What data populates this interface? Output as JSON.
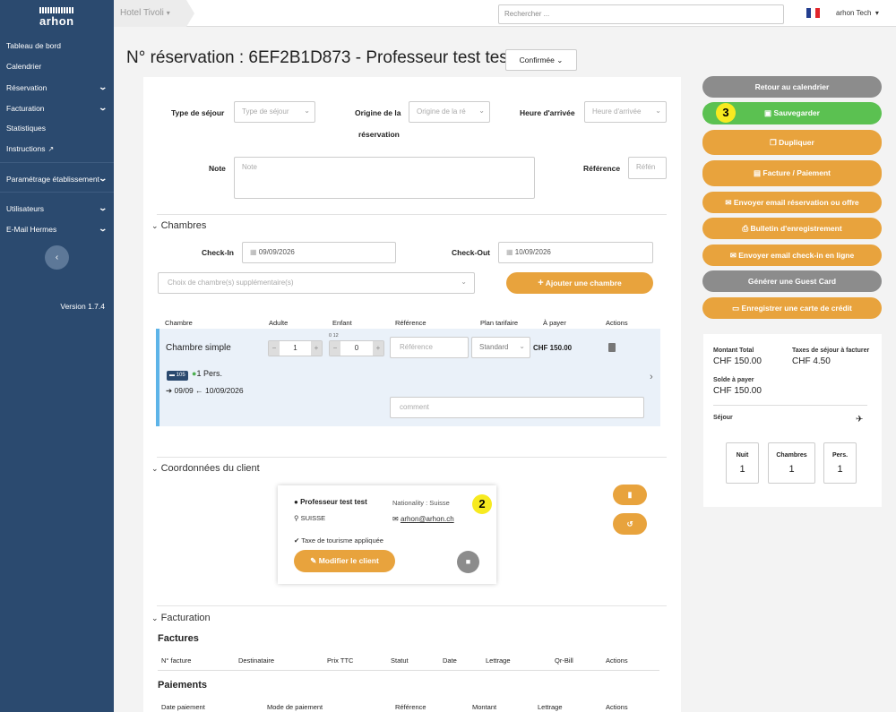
{
  "app": {
    "logo_text": "arhon",
    "version": "Version 1.7.4"
  },
  "sidebar": {
    "items": [
      {
        "label": "Tableau de bord",
        "chevron": false
      },
      {
        "label": "Calendrier",
        "chevron": false
      },
      {
        "label": "Réservation",
        "chevron": true
      },
      {
        "label": "Facturation",
        "chevron": true
      },
      {
        "label": "Statistiques",
        "chevron": false
      },
      {
        "label": "Instructions",
        "chevron": false
      },
      {
        "label": "Paramétrage établissement",
        "chevron": true
      },
      {
        "label": "Utilisateurs",
        "chevron": true
      },
      {
        "label": "E-Mail Hermes",
        "chevron": true
      }
    ]
  },
  "topbar": {
    "hotel": "Hotel Tivoli",
    "search_placeholder": "Rechercher ...",
    "user": "arhon Tech"
  },
  "page": {
    "title": "N° réservation : 6EF2B1D873 - Professeur test test",
    "status": "Confirmée"
  },
  "form": {
    "type_sejour_label": "Type de séjour",
    "type_sejour_placeholder": "Type de séjour",
    "origine_label_1": "Origine de la",
    "origine_label_2": "réservation",
    "origine_placeholder": "Origine de la ré",
    "heure_label": "Heure d'arrivée",
    "heure_placeholder": "Heure d'arrivée",
    "note_label": "Note",
    "note_placeholder": "Note",
    "reference_label": "Référence",
    "reference_placeholder": "Réfén"
  },
  "chambres": {
    "title": "Chambres",
    "checkin_label": "Check-In",
    "checkin": "09/09/2026",
    "checkout_label": "Check-Out",
    "checkout": "10/09/2026",
    "choice_placeholder": "Choix de chambre(s) supplémentaire(s)",
    "add_button": "Ajouter une chambre",
    "headers": [
      "Chambre",
      "Adulte",
      "Enfant",
      "Référence",
      "Plan tarifaire",
      "À payer",
      "Actions"
    ],
    "room": {
      "name": "Chambre simple",
      "adults": "1",
      "child_ages": "0 12",
      "children": "0",
      "reference_placeholder": "Référence",
      "plan": "Standard",
      "price": "CHF 150.00",
      "room_number": "105",
      "persons": "1 Pers.",
      "arrival": "09/09",
      "departure": "10/09/2026",
      "comment_placeholder": "comment"
    }
  },
  "client": {
    "title": "Coordonnées du client",
    "name": "Professeur  test test",
    "nationality": "Nationality : Suisse",
    "country": "SUISSE",
    "email": "arhon@arhon.ch",
    "tax": "Taxe de tourisme appliquée",
    "edit_button": "Modifier le client",
    "badge": "2"
  },
  "facturation": {
    "title": "Facturation",
    "factures_title": "Factures",
    "factures_headers": [
      "N° facture",
      "Destinataire",
      "Prix TTC",
      "Statut",
      "Date",
      "Lettrage",
      "Qr-Bill",
      "Actions"
    ],
    "paiements_title": "Paiements",
    "paiements_headers": [
      "Date paiement",
      "Mode de paiement",
      "Référence",
      "Montant",
      "Lettrage",
      "Actions"
    ]
  },
  "actions": {
    "back": "Retour au calendrier",
    "save": "Sauvegarder",
    "save_badge": "3",
    "duplicate": "Dupliquer",
    "invoice": "Facture / Paiement",
    "email_offer": "Envoyer email réservation ou offre",
    "bulletin": "Bulletin d'enregistrement",
    "email_checkin": "Envoyer email check-in en ligne",
    "guest_card": "Générer une Guest Card",
    "credit_card": "Enregistrer une carte de crédit"
  },
  "summary": {
    "montant_label": "Montant Total",
    "montant": "CHF 150.00",
    "taxes_label": "Taxes de séjour à facturer",
    "taxes": "CHF 4.50",
    "solde_label": "Solde à payer",
    "solde": "CHF 150.00",
    "sejour_label": "Séjour",
    "nuit_label": "Nuit",
    "nuit": "1",
    "chambres_label": "Chambres",
    "chambres": "1",
    "pers_label": "Pers.",
    "pers": "1"
  },
  "colors": {
    "sidebar": "#2b4a6f",
    "orange": "#e8a33d",
    "green": "#5bc151",
    "gray": "#8c8c8c",
    "badge": "#f7ea20"
  }
}
